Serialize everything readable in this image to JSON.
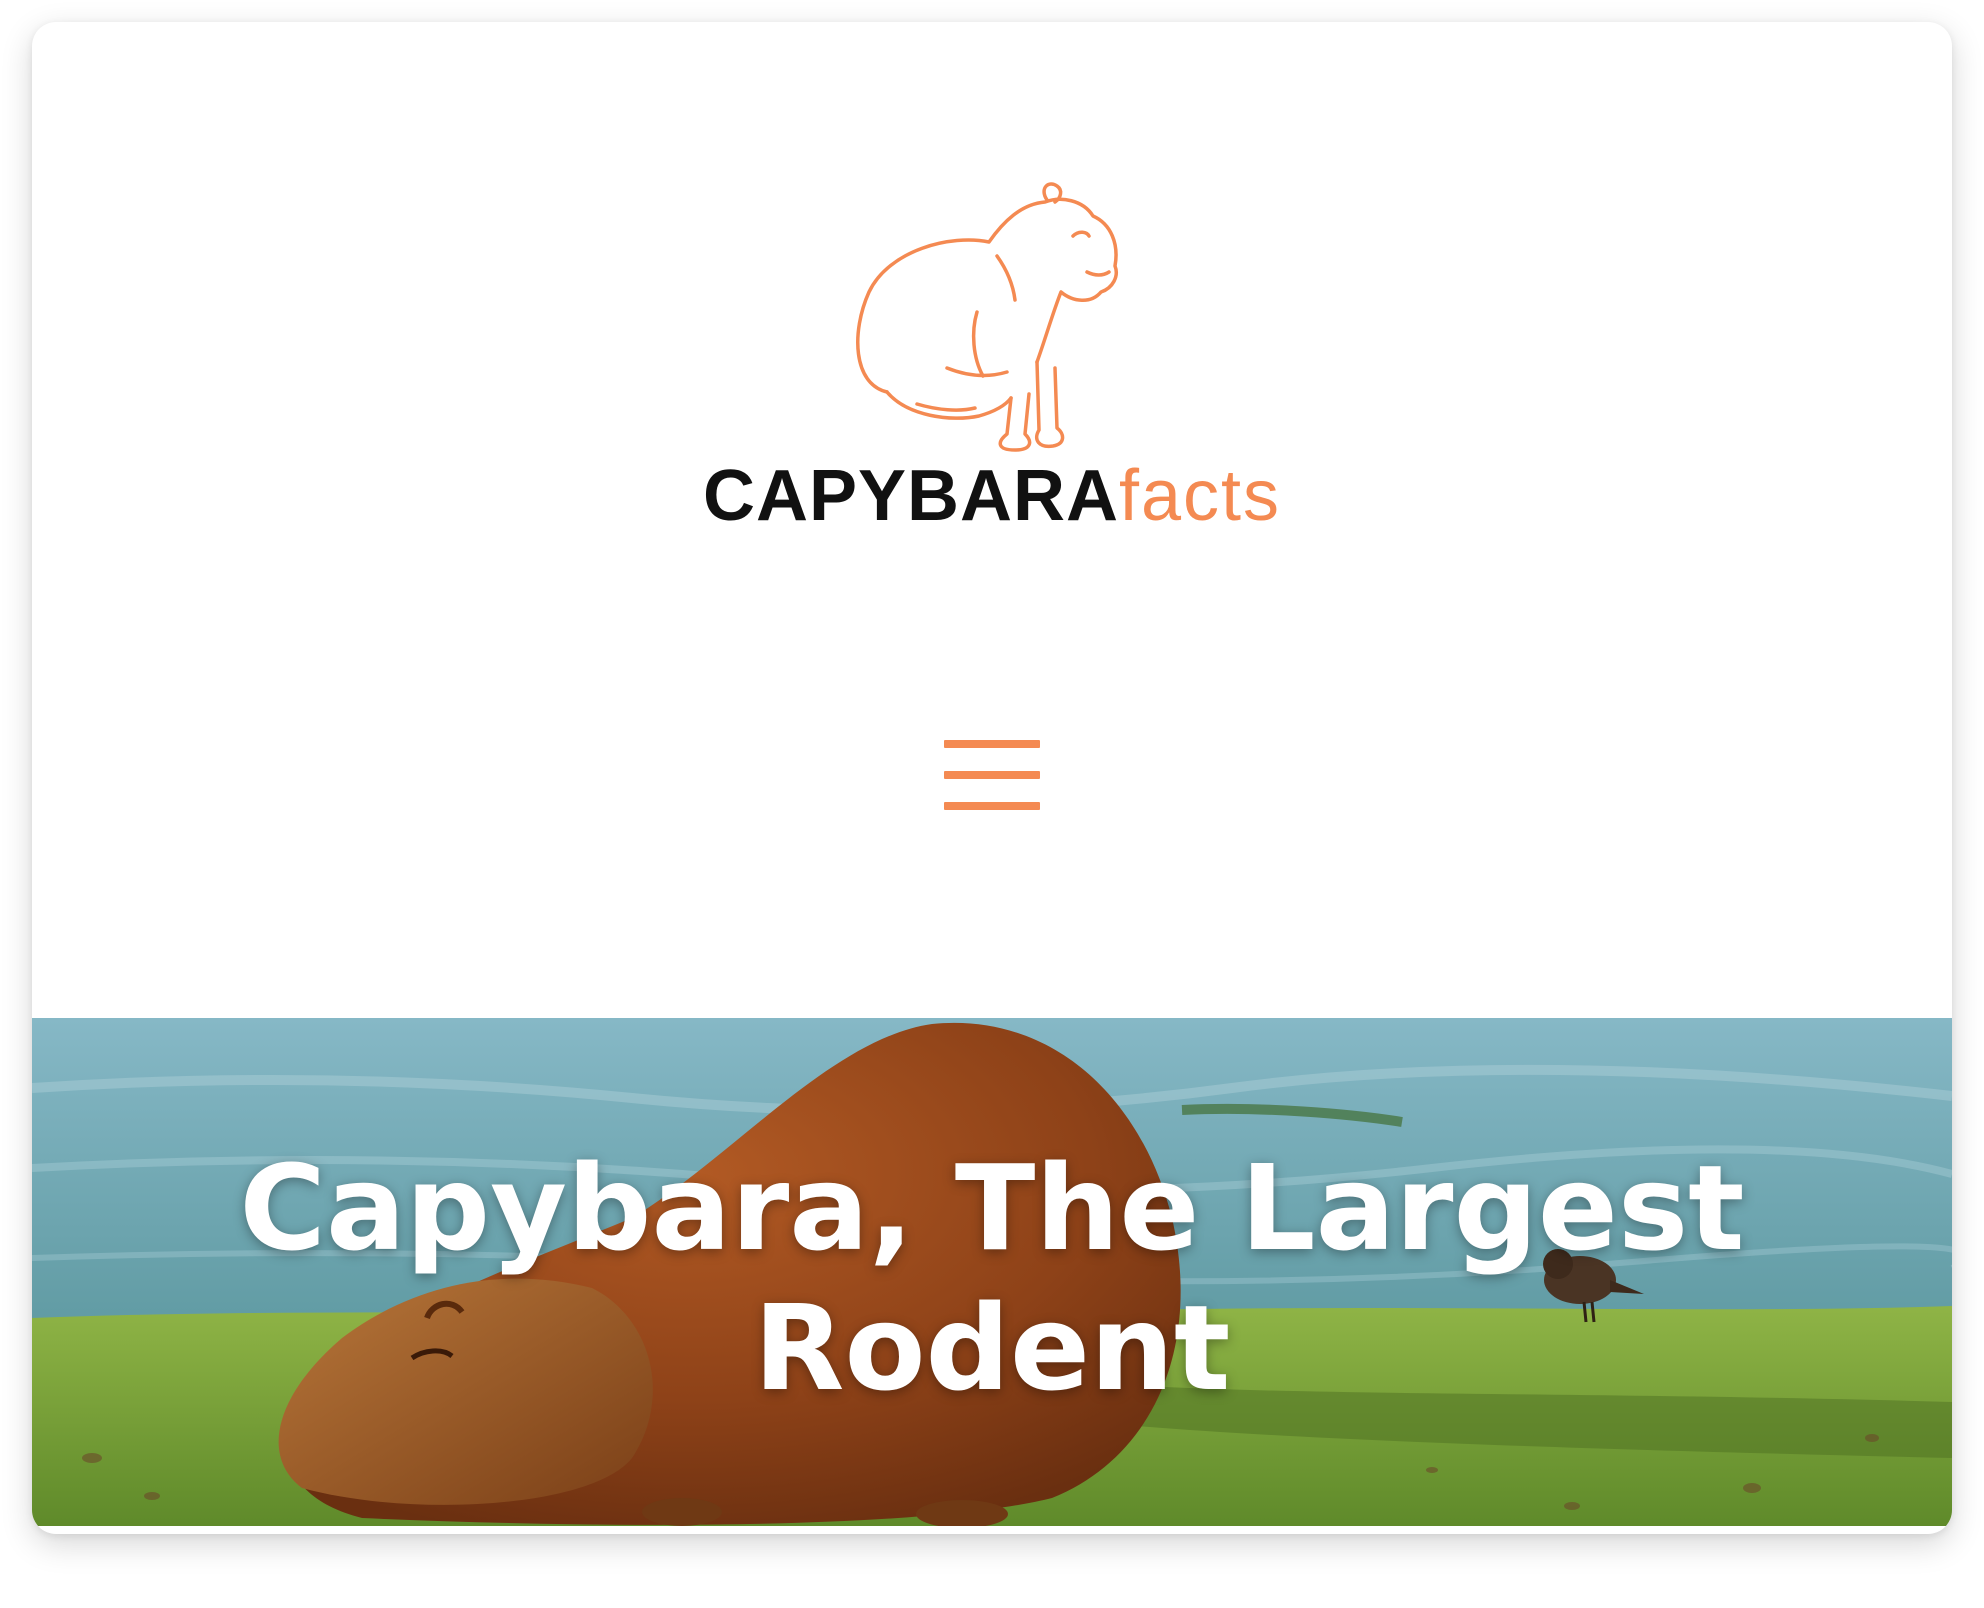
{
  "logo": {
    "word_primary": "CAPYBARA",
    "word_secondary": "facts",
    "icon": "capybara-outline-icon"
  },
  "menu": {
    "icon": "hamburger-menu-icon"
  },
  "hero": {
    "title": "Capybara, The Largest Rodent",
    "image": "capybara-lying-on-grass-photo"
  },
  "colors": {
    "accent": "#f48a52",
    "text_dark": "#111111",
    "hero_text": "#ffffff",
    "water": "#7fb2bd",
    "grass": "#7fa63a",
    "fur": "#9b4a1e"
  }
}
